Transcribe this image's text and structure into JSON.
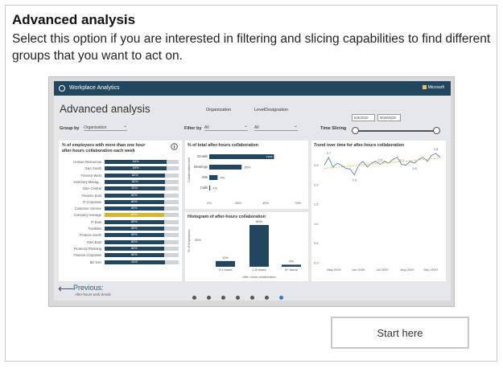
{
  "card": {
    "title": "Advanced analysis",
    "description": "Select this option if you are interested in filtering and slicing capabilities to find different groups that you want to act on."
  },
  "preview": {
    "app_name": "Workplace Analytics",
    "brand": "Microsoft",
    "page_title": "Advanced analysis",
    "group_by_label": "Group by",
    "group_by_value": "Organization",
    "filter_by_label": "Filter by",
    "org_label": "Organization",
    "org_value": "All",
    "level_label": "LevelDesignation",
    "level_value": "All",
    "time_slicing_label": "Time Slicing",
    "date_start": "5/3/2020",
    "date_end": "9/19/2020",
    "left_chart": {
      "title_line1": "% of employees with more than one hour",
      "title_line2": "after-hours collaboration each week",
      "info_icon": "info-icon",
      "highlight_color": "#d9b52b",
      "bar_color": "#23465f",
      "rows": [
        {
          "category": "Human Resources",
          "value": 84
        },
        {
          "category": "G&A South",
          "value": 84
        },
        {
          "category": "Finance West",
          "value": 82
        },
        {
          "category": "Inventory Manag...",
          "value": 82
        },
        {
          "category": "G&A Central",
          "value": 81
        },
        {
          "category": "Finance East",
          "value": 80
        },
        {
          "category": "IT Corporate",
          "value": 80
        },
        {
          "category": "Customer Service",
          "value": 80
        },
        {
          "category": "Company Average",
          "value": 80,
          "highlight": true
        },
        {
          "category": "IT East",
          "value": 80
        },
        {
          "category": "Facilities",
          "value": 80
        },
        {
          "category": "Finance South",
          "value": 80
        },
        {
          "category": "G&A East",
          "value": 80
        },
        {
          "category": "Financial Planning",
          "value": 80
        },
        {
          "category": "Finance Corporate",
          "value": 80
        },
        {
          "category": "Biz Dev",
          "value": 81
        }
      ]
    },
    "mid_top_chart": {
      "title": "% of total after-hours collaboration",
      "ylabel": "Collaboration tool",
      "categories": [
        "Emails",
        "Meetings",
        "IMs",
        "Calls"
      ],
      "labels": [
        "70%",
        "35%",
        "9%",
        "1%"
      ],
      "values": [
        70,
        35,
        9,
        1
      ],
      "ticks": [
        "0%",
        "25%",
        "45%",
        "70%"
      ]
    },
    "mid_bottom_chart": {
      "title": "Histogram of after-hours collaboration",
      "ylabel": "% of employees",
      "xlabel": "After-hours collaboration",
      "ytick": "35%",
      "categories": [
        "0-1 hours",
        "1-5 hours",
        "5+ hours"
      ],
      "labels": [
        "11%",
        "80%",
        "4%"
      ],
      "values": [
        11,
        80,
        4
      ]
    },
    "right_chart": {
      "title": "Trend over time for after-hours collaboration",
      "y_ticks": [
        "2.5",
        "2.0",
        "1.5",
        "1.0",
        "0.5",
        "0.0"
      ],
      "x_ticks": [
        "May 2020",
        "Jun 2020",
        "Jul 2020",
        "Aug 2020",
        "Sep 2020"
      ],
      "point_labels": [
        "2.7",
        "2.3",
        "2.5",
        "2.7",
        "2.6",
        "2.8"
      ],
      "trend_color": "#d9b52b",
      "line_color": "#5a7ea6"
    },
    "previous": {
      "label": "Previous:",
      "sub": "After-hours work trends"
    },
    "pager": {
      "total": 7,
      "active_index": 6
    }
  },
  "actions": {
    "start_label": "Start here"
  }
}
